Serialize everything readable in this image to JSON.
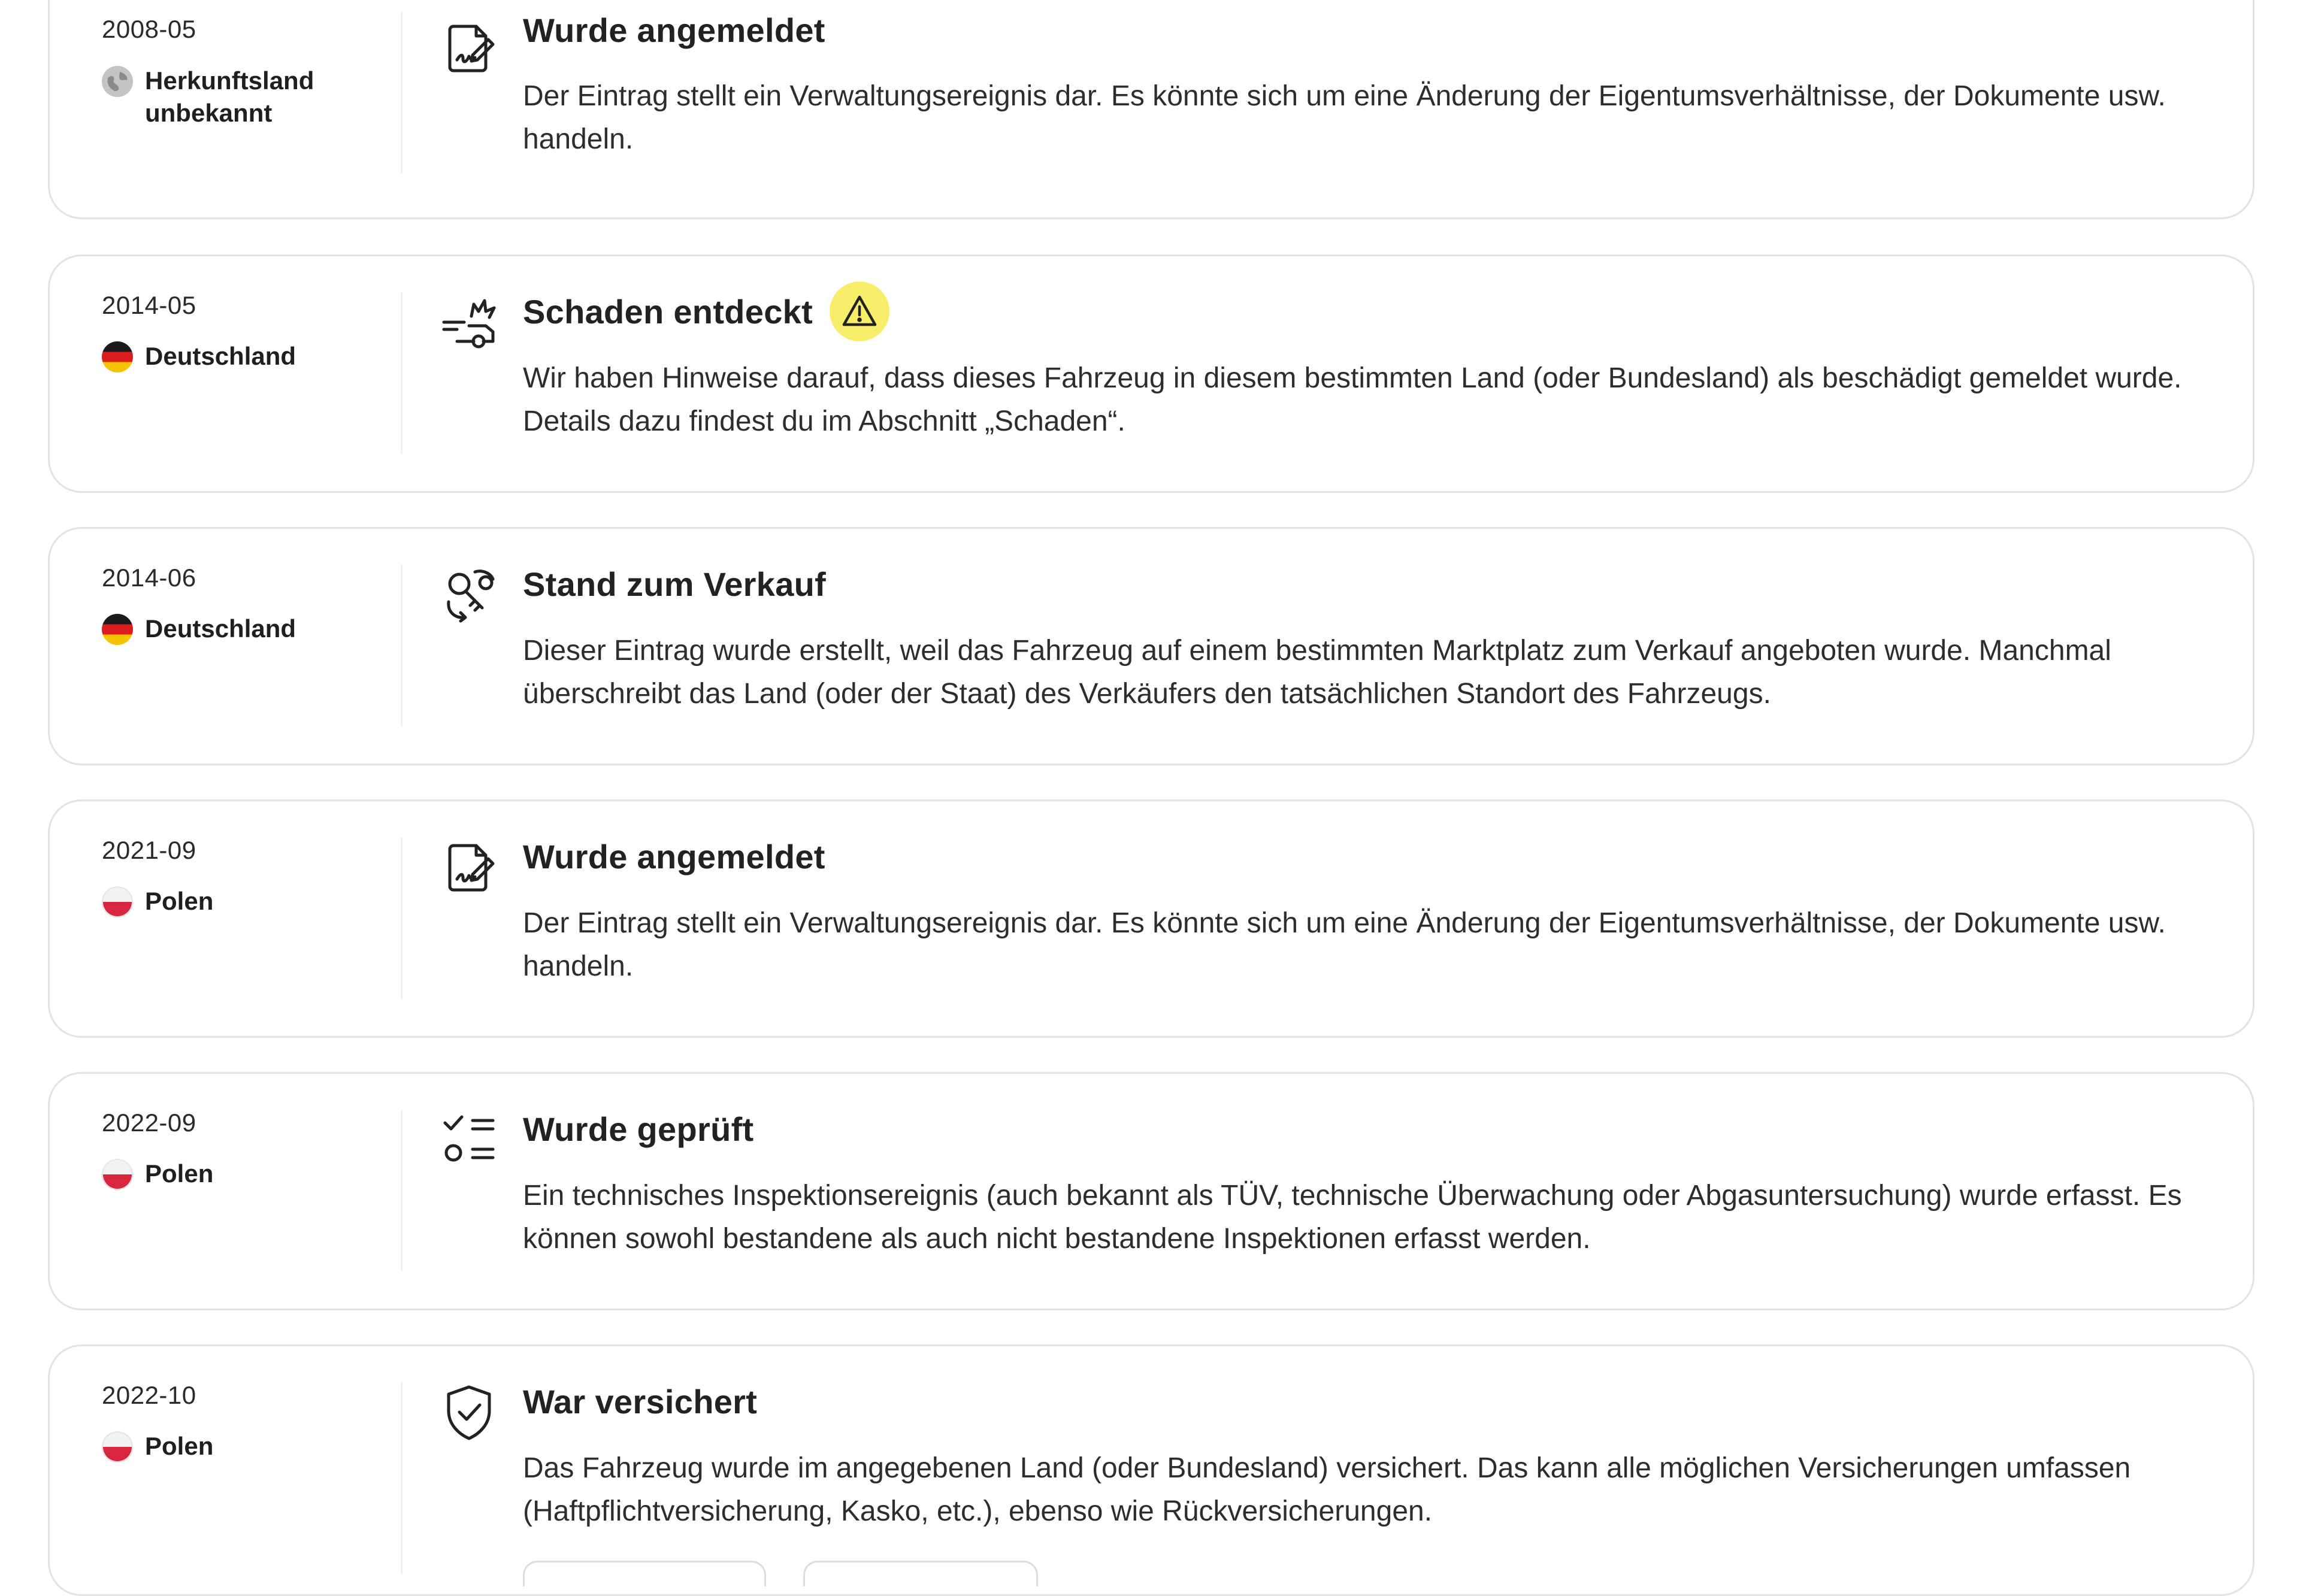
{
  "events": [
    {
      "date": "2008-05",
      "country_line1": "Herkunftsland",
      "country_line2": "unbekannt",
      "flag": "globe-icon",
      "icon": "document-signature-icon",
      "title": "Wurde angemeldet",
      "description": "Der Eintrag stellt ein Verwaltungsereignis dar. Es könnte sich um eine Änderung der Eigentumsverhältnisse, der Dokumente usw. handeln."
    },
    {
      "date": "2014-05",
      "country_line1": "Deutschland",
      "flag": "germany-flag-icon",
      "icon": "car-crash-icon",
      "title": "Schaden entdeckt",
      "warning": "warning-triangle-icon",
      "warning_color": "#f8ee6a",
      "description": "Wir haben Hinweise darauf, dass dieses Fahrzeug in diesem bestimmten Land (oder Bundesland) als beschädigt gemeldet wurde. Details dazu findest du im Abschnitt „Schaden“."
    },
    {
      "date": "2014-06",
      "country_line1": "Deutschland",
      "flag": "germany-flag-icon",
      "icon": "key-exchange-icon",
      "title": "Stand zum Verkauf",
      "description": "Dieser Eintrag wurde erstellt, weil das Fahrzeug auf einem bestimmten Marktplatz zum Verkauf angeboten wurde. Manchmal überschreibt das Land (oder der Staat) des Verkäufers den tatsächlichen Standort des Fahrzeugs."
    },
    {
      "date": "2021-09",
      "country_line1": "Polen",
      "flag": "poland-flag-icon",
      "icon": "document-signature-icon",
      "title": "Wurde angemeldet",
      "description": "Der Eintrag stellt ein Verwaltungsereignis dar. Es könnte sich um eine Änderung der Eigentumsverhältnisse, der Dokumente usw. handeln."
    },
    {
      "date": "2022-09",
      "country_line1": "Polen",
      "flag": "poland-flag-icon",
      "icon": "checklist-icon",
      "title": "Wurde geprüft",
      "description": "Ein technisches Inspektionsereignis (auch bekannt als TÜV, technische Überwachung oder Abgasuntersuchung) wurde erfasst. Es können sowohl bestandene als auch nicht bestandene Inspektionen erfasst werden."
    },
    {
      "date": "2022-10",
      "country_line1": "Polen",
      "flag": "poland-flag-icon",
      "icon": "shield-check-icon",
      "title": "War versichert",
      "description": "Das Fahrzeug wurde im angegebenen Land (oder Bundesland) versichert. Das kann alle möglichen Versicherungen umfassen (Haftpflichtversicherung, Kasko, etc.), ebenso wie Rückversicherungen."
    }
  ]
}
